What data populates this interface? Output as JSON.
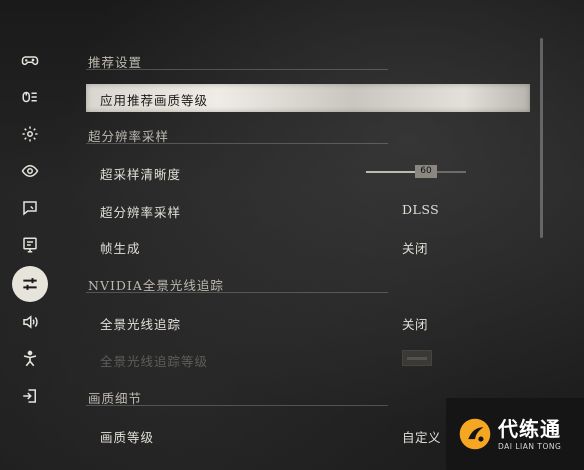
{
  "sidebar": {
    "items": [
      {
        "icon": "gamepad-icon",
        "active": false
      },
      {
        "icon": "keyboard-mouse-icon",
        "active": false
      },
      {
        "icon": "gear-icon",
        "active": false
      },
      {
        "icon": "eye-icon",
        "active": false
      },
      {
        "icon": "chat-bubble-icon",
        "active": false
      },
      {
        "icon": "monitor-icon",
        "active": false
      },
      {
        "icon": "sliders-icon",
        "active": true
      },
      {
        "icon": "speaker-icon",
        "active": false
      },
      {
        "icon": "accessibility-icon",
        "active": false
      },
      {
        "icon": "exit-icon",
        "active": false
      }
    ]
  },
  "sections": {
    "recommended": {
      "title": "推荐设置",
      "apply_label": "应用推荐画质等级"
    },
    "super_resolution": {
      "title": "超分辨率采样",
      "sharpness_label": "超采样清晰度",
      "sharpness_value": "60",
      "sharpness_fraction": 0.6,
      "method_label": "超分辨率采样",
      "method_value": "DLSS",
      "frame_gen_label": "帧生成",
      "frame_gen_value": "关闭"
    },
    "ray_tracing": {
      "title": "NVIDIA全景光线追踪",
      "rt_label": "全景光线追踪",
      "rt_value": "关闭",
      "rt_level_label": "全景光线追踪等级"
    },
    "detail": {
      "title": "画质细节",
      "quality_label": "画质等级",
      "quality_value": "自定义"
    }
  },
  "watermark": {
    "main": "代练通",
    "sub": "DAI LIAN TONG"
  },
  "colors": {
    "selected_row": "#e3e0d9",
    "accent": "#f5a623"
  }
}
